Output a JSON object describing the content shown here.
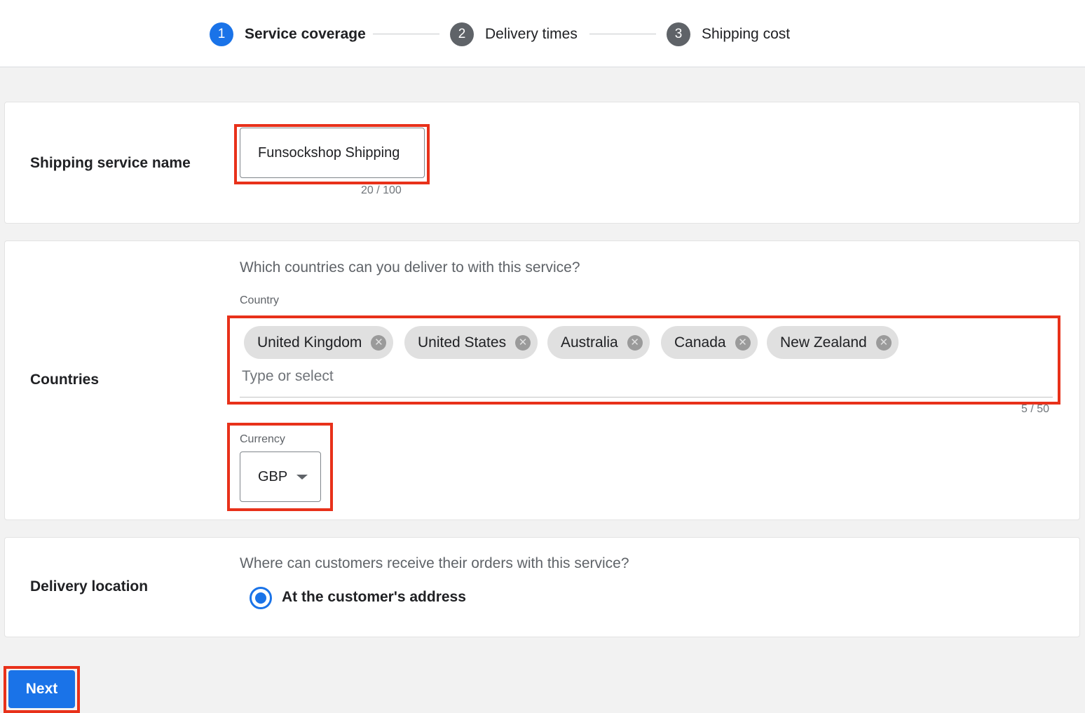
{
  "stepper": {
    "steps": [
      {
        "number": "1",
        "label": "Service coverage"
      },
      {
        "number": "2",
        "label": "Delivery times"
      },
      {
        "number": "3",
        "label": "Shipping cost"
      }
    ],
    "active_step": "1"
  },
  "service_name": {
    "label": "Shipping service name",
    "value": "Funsockshop Shipping",
    "counter": "20 / 100"
  },
  "countries": {
    "label": "Countries",
    "question": "Which countries can you deliver to with this service?",
    "field_label": "Country",
    "chips": [
      "United Kingdom",
      "United States",
      "Australia",
      "Canada",
      "New Zealand"
    ],
    "placeholder": "Type or select",
    "counter": "5 / 50"
  },
  "currency": {
    "label": "Currency",
    "value": "GBP"
  },
  "delivery_location": {
    "label": "Delivery location",
    "question": "Where can customers receive their orders with this service?",
    "option": "At the customer's address",
    "selected": true
  },
  "actions": {
    "next_label": "Next"
  },
  "colors": {
    "primary": "#1a73e8",
    "step_inactive": "#5f6368",
    "highlight": "#e8311a"
  },
  "icons": {
    "chip_remove": "close-circle-icon",
    "dropdown": "caret-down-icon"
  }
}
